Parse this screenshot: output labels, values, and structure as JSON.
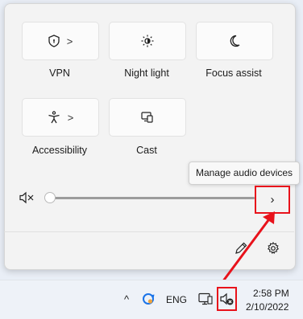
{
  "quick_settings": {
    "tiles": [
      {
        "label": "VPN",
        "icon": "shield-icon",
        "has_chevron": true
      },
      {
        "label": "Night light",
        "icon": "brightness-icon",
        "has_chevron": false
      },
      {
        "label": "Focus assist",
        "icon": "moon-icon",
        "has_chevron": false
      },
      {
        "label": "Accessibility",
        "icon": "accessibility-icon",
        "has_chevron": true
      },
      {
        "label": "Cast",
        "icon": "cast-icon",
        "has_chevron": false
      }
    ],
    "chevron_glyph": ">",
    "volume": {
      "icon": "speaker-muted-icon",
      "level_fraction": 0,
      "tooltip": "Manage audio devices",
      "audio_button_glyph": "›"
    },
    "footer": {
      "edit_icon": "pencil-icon",
      "settings_icon": "gear-icon"
    }
  },
  "taskbar": {
    "chevron_up": "^",
    "language": "ENG",
    "time": "2:58 PM",
    "date": "2/10/2022",
    "icons": [
      "onedrive-sync-icon",
      "network-icon",
      "volume-muted-icon"
    ]
  },
  "colors": {
    "highlight_red": "#e8121b",
    "panel_bg": "#f3f3f3",
    "taskbar_bg": "#eef2f8"
  }
}
